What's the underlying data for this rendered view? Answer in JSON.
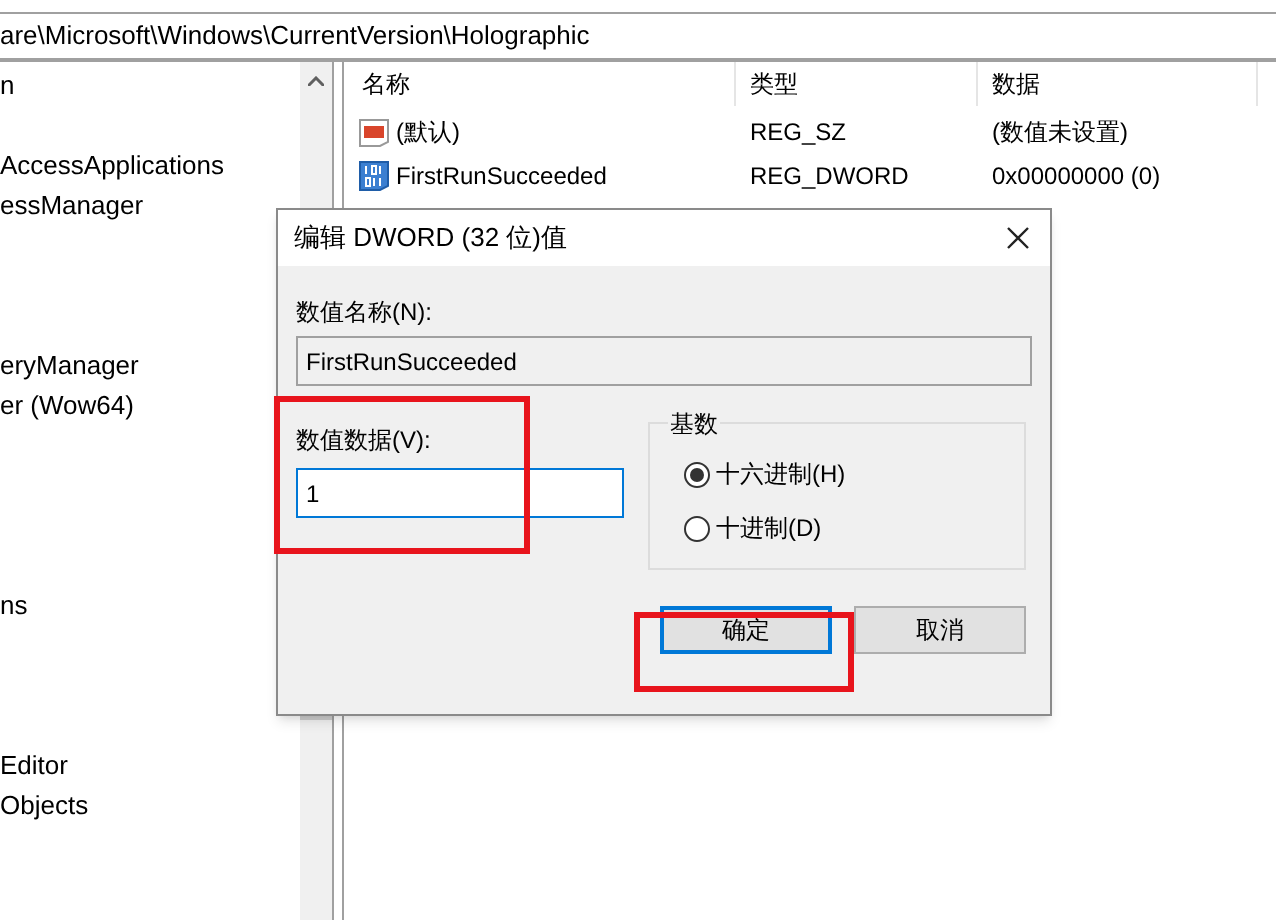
{
  "address_bar": {
    "path": "are\\Microsoft\\Windows\\CurrentVersion\\Holographic"
  },
  "tree": {
    "items": [
      {
        "label": "n"
      },
      {
        "label": "AccessApplications"
      },
      {
        "label": "essManager"
      },
      {
        "label": "eryManager"
      },
      {
        "label": "er (Wow64)"
      },
      {
        "label": "ns"
      },
      {
        "label": "Editor"
      },
      {
        "label": "Objects"
      }
    ]
  },
  "values_list": {
    "columns": [
      "名称",
      "类型",
      "数据"
    ],
    "rows": [
      {
        "kind": "string",
        "name": "(默认)",
        "type": "REG_SZ",
        "data": "(数值未设置)"
      },
      {
        "kind": "binary",
        "name": "FirstRunSucceeded",
        "type": "REG_DWORD",
        "data": "0x00000000 (0)"
      }
    ]
  },
  "dialog": {
    "title": "编辑 DWORD (32 位)值",
    "name_label": "数值名称(N):",
    "name_value": "FirstRunSucceeded",
    "data_label": "数值数据(V):",
    "data_value": "1",
    "base_label": "基数",
    "base_options": [
      {
        "label": "十六进制(H)",
        "selected": true
      },
      {
        "label": "十进制(D)",
        "selected": false
      }
    ],
    "buttons": [
      {
        "label": "确定",
        "focused": true
      },
      {
        "label": "取消",
        "focused": false
      }
    ]
  }
}
